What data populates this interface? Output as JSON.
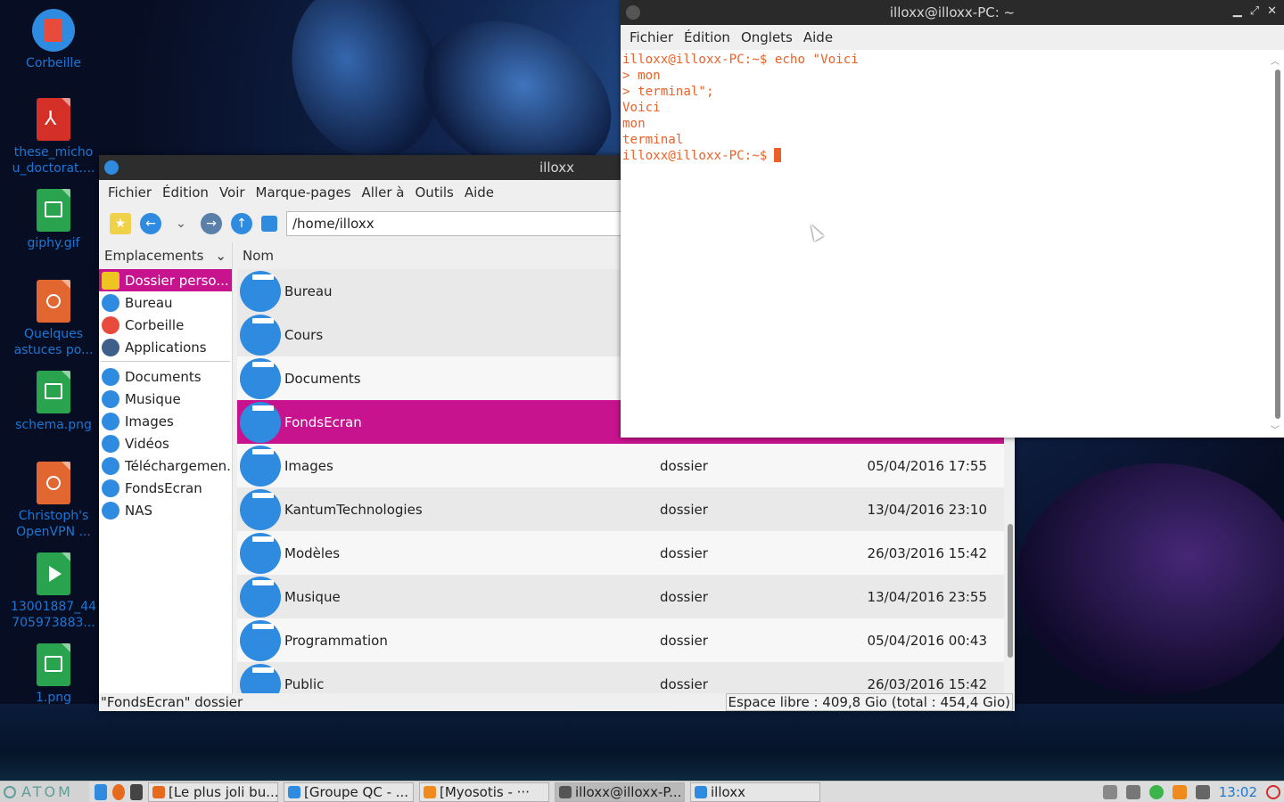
{
  "desktop": {
    "icons": [
      {
        "label": "Corbeille",
        "type": "trash",
        "icon": "trash-icon"
      },
      {
        "label": "these_micho u_doctorat....",
        "type": "pdf",
        "icon": "pdf-file-icon"
      },
      {
        "label": "giphy.gif",
        "type": "image",
        "icon": "image-file-icon"
      },
      {
        "label": "Quelques astuces po...",
        "type": "html",
        "icon": "html-file-icon"
      },
      {
        "label": "schema.png",
        "type": "image",
        "icon": "image-file-icon"
      },
      {
        "label": "Christoph's OpenVPN ...",
        "type": "html",
        "icon": "html-file-icon"
      },
      {
        "label": "13001887_44 705973883...",
        "type": "video",
        "icon": "video-file-icon"
      },
      {
        "label": "1.png",
        "type": "image",
        "icon": "image-file-icon"
      }
    ]
  },
  "file_manager": {
    "title": "illoxx",
    "menu": [
      "Fichier",
      "Édition",
      "Voir",
      "Marque-pages",
      "Aller à",
      "Outils",
      "Aide"
    ],
    "path": "/home/illoxx",
    "sidebar": {
      "header": "Emplacements",
      "items": [
        {
          "label": "Dossier perso...",
          "selected": true
        },
        {
          "label": "Bureau"
        },
        {
          "label": "Corbeille"
        },
        {
          "label": "Applications"
        },
        {
          "label": "Documents"
        },
        {
          "label": "Musique"
        },
        {
          "label": "Images"
        },
        {
          "label": "Vidéos"
        },
        {
          "label": "Télécharge­men..."
        },
        {
          "label": "FondsEcran"
        },
        {
          "label": "NAS"
        }
      ]
    },
    "column_name": "Nom",
    "rows": [
      {
        "name": "Bureau",
        "type": "",
        "date": ""
      },
      {
        "name": "Cours",
        "type": "",
        "date": ""
      },
      {
        "name": "Documents",
        "type": "",
        "date": ""
      },
      {
        "name": "FondsEcran",
        "type": "",
        "date": "",
        "selected": true
      },
      {
        "name": "Images",
        "type": "dossier",
        "date": "05/04/2016 17:55"
      },
      {
        "name": "KantumTechnologies",
        "type": "dossier",
        "date": "13/04/2016 23:10"
      },
      {
        "name": "Modèles",
        "type": "dossier",
        "date": "26/03/2016 15:42"
      },
      {
        "name": "Musique",
        "type": "dossier",
        "date": "13/04/2016 23:55"
      },
      {
        "name": "Programmation",
        "type": "dossier",
        "date": "05/04/2016 00:43"
      },
      {
        "name": "Public",
        "type": "dossier",
        "date": "26/03/2016 15:42"
      }
    ],
    "status_left": "\"FondsEcran\" dossier",
    "status_right": "Espace libre : 409,8 Gio (total : 454,4 Gio)"
  },
  "terminal": {
    "title": "illoxx@illoxx-PC: ~",
    "menu": [
      "Fichier",
      "Édition",
      "Onglets",
      "Aide"
    ],
    "lines": [
      "illoxx@illoxx-PC:~$ echo \"Voici",
      "> mon",
      "> terminal\";",
      "Voici",
      "mon",
      "terminal"
    ],
    "prompt": "illoxx@illoxx-PC:~$"
  },
  "taskbar": {
    "start_label": "ATOM",
    "tasks": [
      {
        "label": "[Le plus joli bu...",
        "icon": "firefox-icon"
      },
      {
        "label": "[Groupe QC - ...",
        "icon": "chat-icon"
      },
      {
        "label": "[Myosotis - ···",
        "icon": "vlc-icon"
      },
      {
        "label": "illoxx@illoxx-P...",
        "icon": "terminal-icon",
        "active": true
      },
      {
        "label": "illoxx",
        "icon": "folder-icon"
      }
    ],
    "clock": "13:02"
  },
  "colors": {
    "selection": "#c8138f",
    "terminal_text": "#e8622a",
    "icon_blue": "#2f8be0"
  }
}
